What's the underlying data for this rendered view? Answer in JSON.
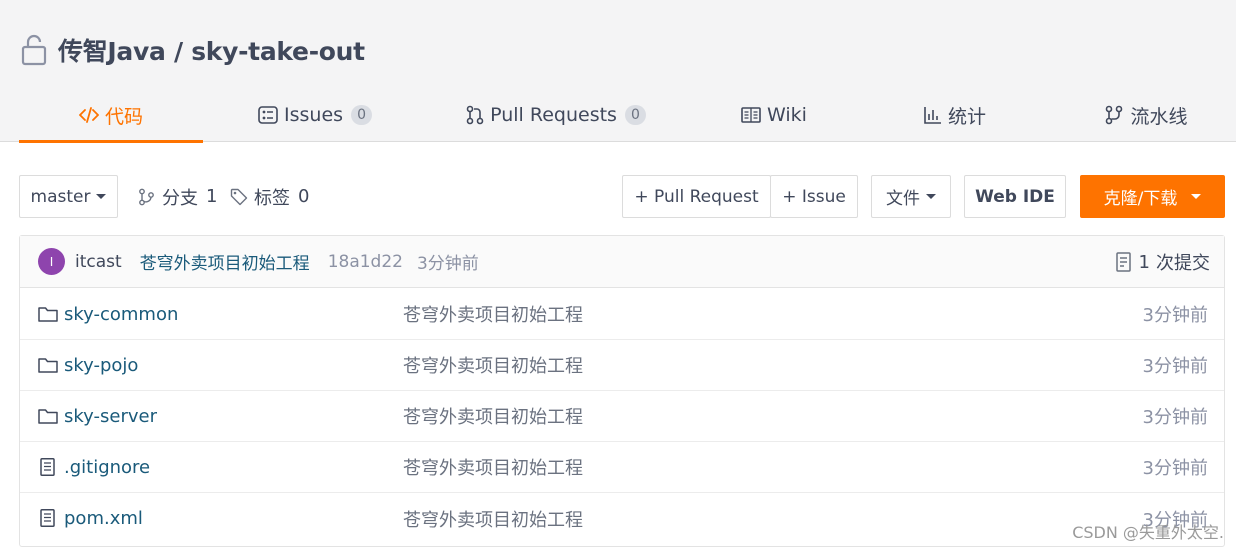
{
  "repo": {
    "owner": "传智Java",
    "separator": " / ",
    "name": "sky-take-out",
    "lock_icon": "lock-icon"
  },
  "tabs": [
    {
      "label": "代码",
      "icon": "code-icon",
      "active": true
    },
    {
      "label": "Issues",
      "icon": "issues-icon",
      "count": "0"
    },
    {
      "label": "Pull Requests",
      "icon": "pull-request-icon",
      "count": "0"
    },
    {
      "label": "Wiki",
      "icon": "wiki-icon"
    },
    {
      "label": "统计",
      "icon": "stats-icon"
    },
    {
      "label": "流水线",
      "icon": "pipeline-icon"
    }
  ],
  "toolbar": {
    "branch": "master",
    "branches_label": "分支",
    "branches_count": "1",
    "tags_label": "标签",
    "tags_count": "0",
    "new_pr": "+ Pull Request",
    "new_issue": "+ Issue",
    "file_menu": "文件",
    "web_ide": "Web IDE",
    "clone": "克隆/下载"
  },
  "commit": {
    "avatar_letter": "I",
    "author": "itcast",
    "message": "苍穹外卖项目初始工程",
    "sha": "18a1d22",
    "time": "3分钟前",
    "commits_count": "1",
    "commits_label": "次提交"
  },
  "files": [
    {
      "name": "sky-common",
      "type": "folder",
      "message": "苍穹外卖项目初始工程",
      "time": "3分钟前"
    },
    {
      "name": "sky-pojo",
      "type": "folder",
      "message": "苍穹外卖项目初始工程",
      "time": "3分钟前"
    },
    {
      "name": "sky-server",
      "type": "folder",
      "message": "苍穹外卖项目初始工程",
      "time": "3分钟前"
    },
    {
      "name": ".gitignore",
      "type": "file",
      "message": "苍穹外卖项目初始工程",
      "time": "3分钟前"
    },
    {
      "name": "pom.xml",
      "type": "file",
      "message": "苍穹外卖项目初始工程",
      "time": "3分钟前"
    }
  ],
  "watermark": "CSDN @失重外太空.",
  "colors": {
    "accent": "#fe7300",
    "link": "#1a5a7a",
    "avatar": "#8e44ad"
  }
}
